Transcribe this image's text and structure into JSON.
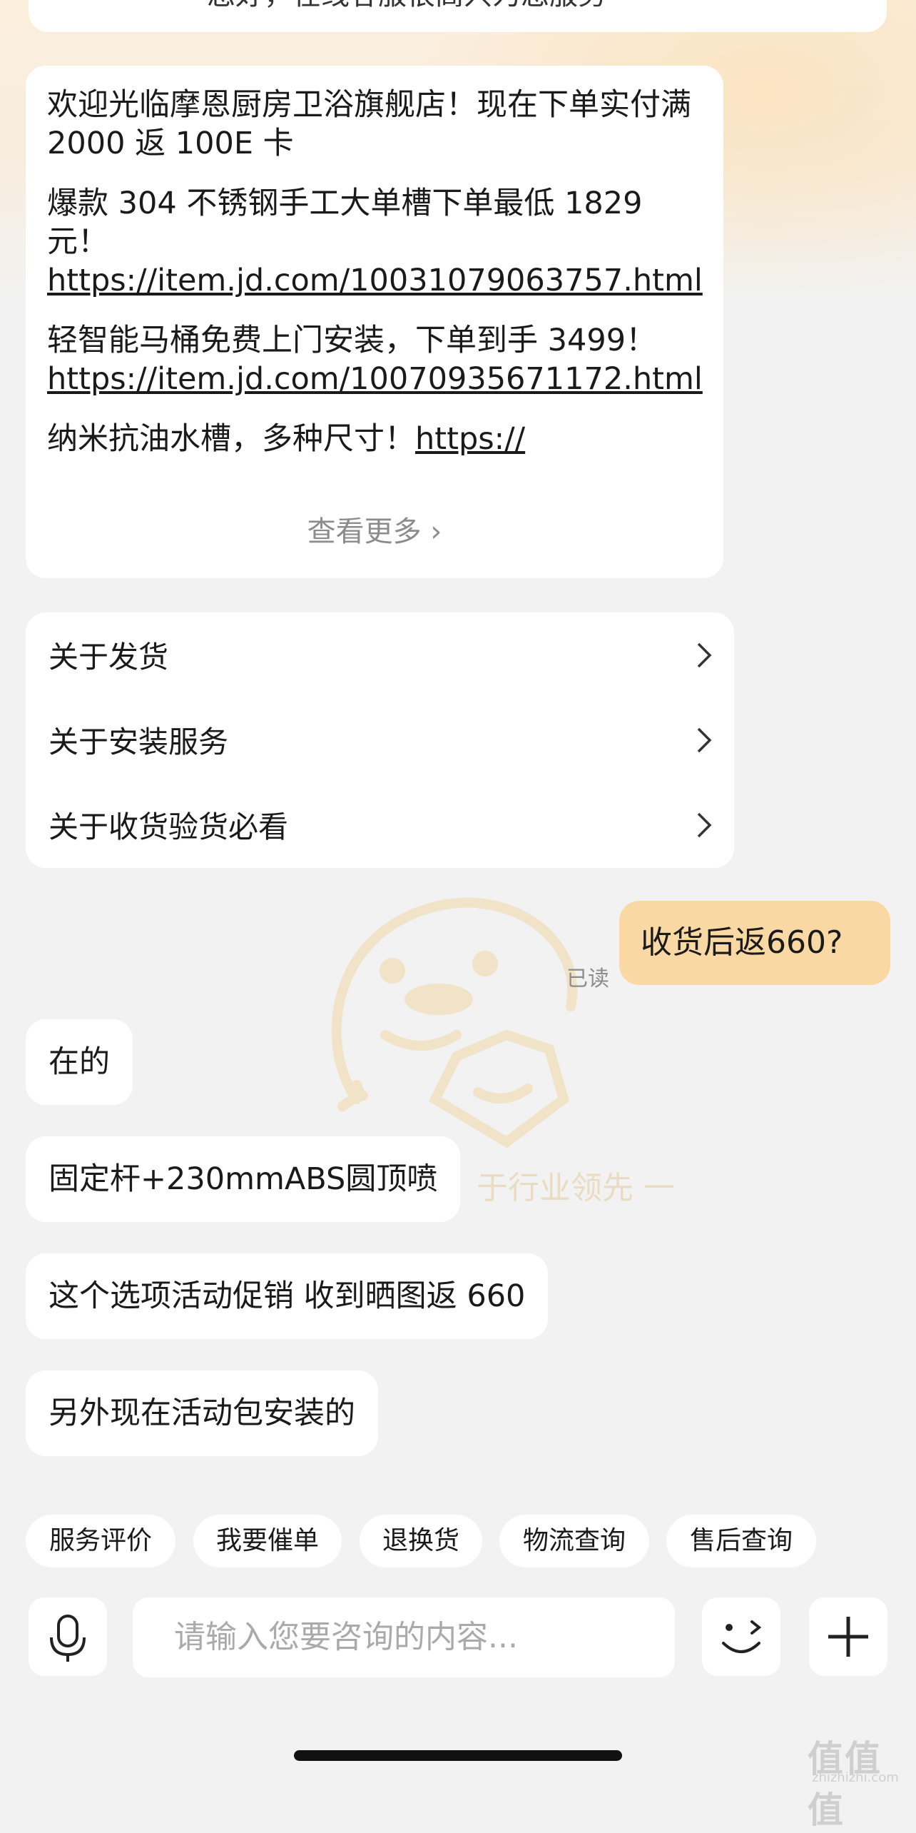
{
  "top_card": {
    "text": "您好，在线客服很高兴为您服务"
  },
  "welcome": {
    "lines": [
      {
        "text": "欢迎光临摩恩厨房卫浴旗舰店！现在下单实付满 2000 返 100E 卡",
        "link": ""
      },
      {
        "text": "爆款 304 不锈钢手工大单槽下单最低 1829 元！",
        "link": "https://item.jd.com/10031079063757.html"
      },
      {
        "text": "轻智能马桶免费上门安装，下单到手 3499！",
        "link": "https://item.jd.com/10070935671172.html"
      },
      {
        "text": "纳米抗油水槽，多种尺寸！",
        "link": "https://"
      }
    ],
    "more_label": "查看更多 ›"
  },
  "faq": {
    "items": [
      {
        "label": "关于发货"
      },
      {
        "label": "关于安装服务"
      },
      {
        "label": "关于收货验货必看"
      }
    ]
  },
  "user_message": {
    "text": "收货后返660?",
    "read_status": "已读"
  },
  "agent_messages": [
    {
      "text": "在的"
    },
    {
      "text": "固定杆+230mmABS圆顶喷"
    },
    {
      "text": "这个选项活动促销 收到晒图返 660"
    },
    {
      "text": "另外现在活动包安装的"
    }
  ],
  "watermark_text": "于行业领先 一",
  "quick_actions": [
    {
      "label": "服务评价"
    },
    {
      "label": "我要催单"
    },
    {
      "label": "退换货"
    },
    {
      "label": "物流查询"
    },
    {
      "label": "售后查询"
    }
  ],
  "input": {
    "placeholder": "请输入您要咨询的内容..."
  },
  "icons": {
    "mic": "microphone-icon",
    "emoji": "emoji-wink-icon",
    "plus": "plus-icon",
    "chevron": "chevron-right-icon"
  },
  "site_watermark": {
    "big": "值值值",
    "small": "zhizhizhi.com"
  },
  "colors": {
    "user_bubble": "#fad8a4",
    "background": "#f2f2f2"
  }
}
